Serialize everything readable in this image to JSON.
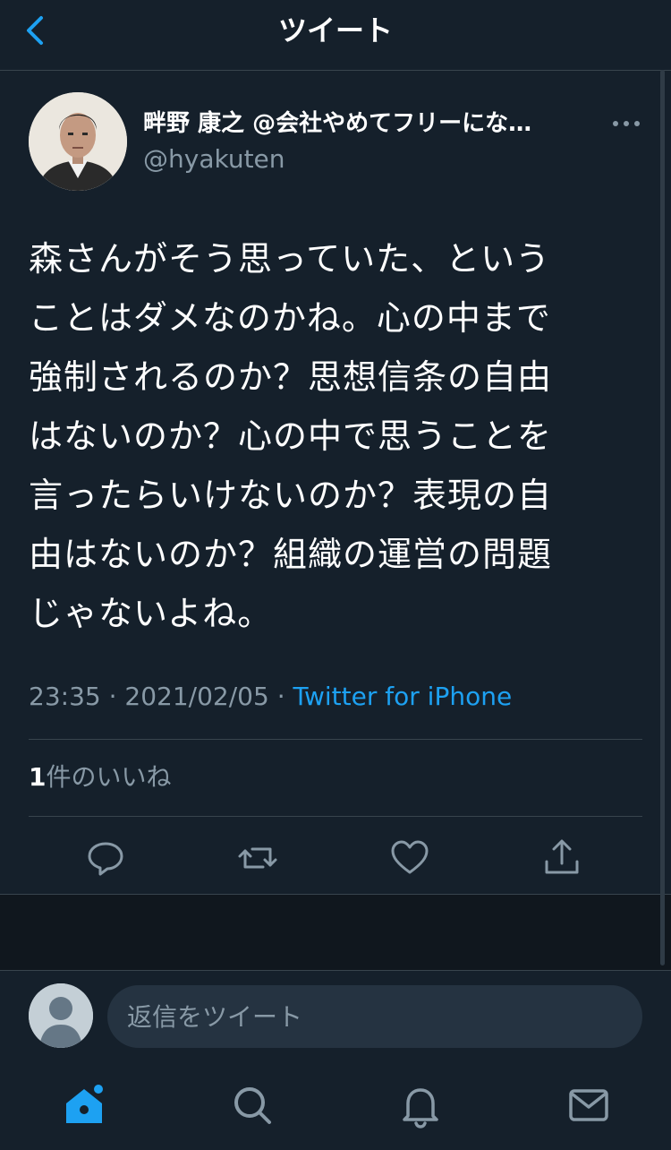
{
  "header": {
    "title": "ツイート",
    "back_icon": "chevron-left-icon"
  },
  "tweet": {
    "display_name": "畔野 康之 @会社やめてフリーにな…",
    "handle": "@hyakuten",
    "text": "森さんがそう思っていた、という\nことはダメなのかね。心の中まで\n強制されるのか？思想信条の自由\nはないのか？心の中で思うことを\n言ったらいけないのか？表現の自\n由はないのか？組織の運営の問題\nじゃないよね。",
    "time": "23:35",
    "date": "2021/02/05",
    "source": "Twitter for iPhone",
    "likes_count": "1",
    "likes_label": "件のいいね"
  },
  "actions": [
    "reply-icon",
    "retweet-icon",
    "like-icon",
    "share-icon"
  ],
  "reply": {
    "placeholder": "返信をツイート"
  },
  "nav": [
    "home-icon",
    "search-icon",
    "notifications-icon",
    "messages-icon"
  ],
  "colors": {
    "background": "#15202b",
    "accent": "#1da1f2",
    "muted": "#8899a6",
    "divider": "#38444d"
  }
}
